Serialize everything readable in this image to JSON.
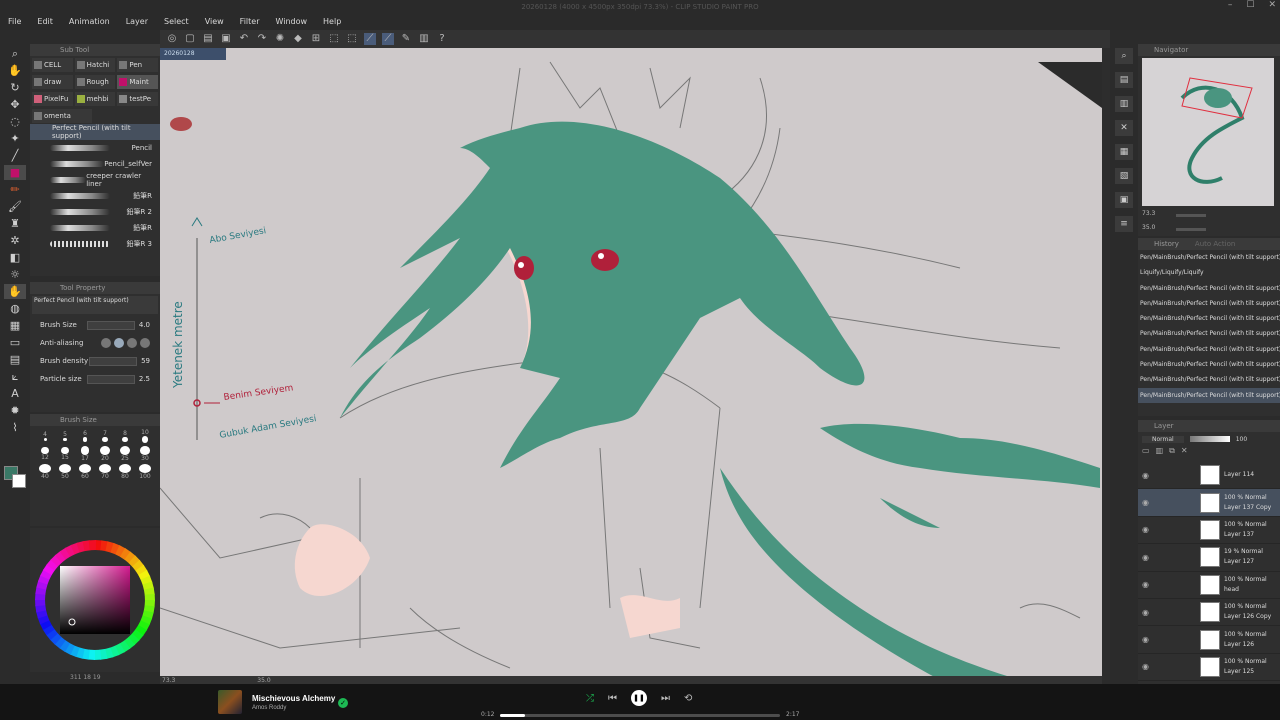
{
  "window": {
    "title": "20260128 (4000 x 4500px 350dpi 73.3%) - CLIP STUDIO PAINT PRO"
  },
  "menu": [
    "File",
    "Edit",
    "Animation",
    "Layer",
    "Select",
    "View",
    "Filter",
    "Window",
    "Help"
  ],
  "document_tab": "20260128",
  "subtool": {
    "panel_title": "Sub Tool",
    "tabs": [
      [
        "CELL",
        "Hatchi",
        "Pen"
      ],
      [
        "draw",
        "Rough",
        "Maint"
      ],
      [
        "PixelFu",
        "mehbi",
        "testPe"
      ],
      [
        "omenta"
      ]
    ],
    "selected_tab": "Maint",
    "brushes": [
      "Perfect Pencil (with tilt support)",
      "Pencil",
      "Pencil_selfVer",
      "creeper crawler liner",
      "鉛筆R",
      "鉛筆R 2",
      "鉛筆R",
      "鉛筆R 3"
    ]
  },
  "tool_property": {
    "panel_title": "Tool Property",
    "brush_name": "Perfect Pencil (with tilt support)",
    "rows": [
      {
        "label": "Brush Size",
        "value": "4.0"
      },
      {
        "label": "Anti-aliasing",
        "value": ""
      },
      {
        "label": "Brush density",
        "value": "59"
      },
      {
        "label": "Particle size",
        "value": "2.5"
      }
    ]
  },
  "brush_size": {
    "panel_title": "Brush Size",
    "sizes": [
      "4",
      "5",
      "6",
      "7",
      "8",
      "10",
      "12",
      "15",
      "17",
      "20",
      "25",
      "30",
      "40",
      "50",
      "60",
      "70",
      "80",
      "100"
    ]
  },
  "left_status": "311  18  19",
  "canvas": {
    "annotations": {
      "top": "Abo Seviyesi",
      "side": "Yetenek metre",
      "mine": "Benim Seviyem",
      "bottom": "Gubuk Adam Seviyesi"
    },
    "status_zoom": "73.3",
    "status_angle": "35.0"
  },
  "navigator": {
    "title": "Navigator",
    "zoom": "73.3",
    "angle": "35.0"
  },
  "history": {
    "title": "History",
    "title2": "Auto Action",
    "items": [
      "Pen/MainBrush/Perfect Pencil (with tilt support)",
      "Liquify/Liquify/Liquify",
      "Pen/MainBrush/Perfect Pencil (with tilt support)",
      "Pen/MainBrush/Perfect Pencil (with tilt support)",
      "Pen/MainBrush/Perfect Pencil (with tilt support)",
      "Pen/MainBrush/Perfect Pencil (with tilt support)",
      "Pen/MainBrush/Perfect Pencil (with tilt support)",
      "Pen/MainBrush/Perfect Pencil (with tilt support)",
      "Pen/MainBrush/Perfect Pencil (with tilt support)",
      "Pen/MainBrush/Perfect Pencil (with tilt support)"
    ],
    "selected_index": 9
  },
  "layers": {
    "title": "Layer",
    "blend": "Normal",
    "opacity": "100",
    "rows": [
      {
        "blend": "",
        "name": "Layer 114"
      },
      {
        "blend": "100 % Normal",
        "name": "Layer 137 Copy"
      },
      {
        "blend": "100 % Normal",
        "name": "Layer 137"
      },
      {
        "blend": "19 % Normal",
        "name": "Layer 127"
      },
      {
        "blend": "100 % Normal",
        "name": "head"
      },
      {
        "blend": "100 % Normal",
        "name": "Layer 126 Copy"
      },
      {
        "blend": "100 % Normal",
        "name": "Layer 126"
      },
      {
        "blend": "100 % Normal",
        "name": "Layer 125"
      }
    ],
    "selected_index": 1
  },
  "media": {
    "track": "Mischievous Alchemy",
    "artist": "Amos Roddy",
    "current_time": "0:12",
    "total_time": "2:17",
    "progress": 0.088
  },
  "colors": {
    "hair": "#4a9580",
    "skin": "#f6d7d0",
    "canvas_bg": "#cfcacb",
    "eye": "#b0203a",
    "accent": "#c0106a"
  }
}
